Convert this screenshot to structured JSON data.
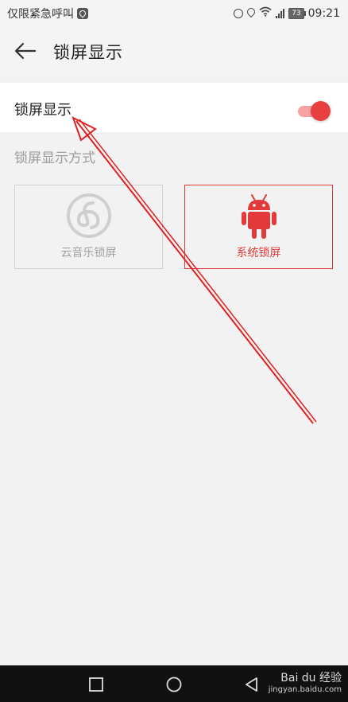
{
  "status_bar": {
    "carrier_text": "仅限紧急呼叫",
    "battery": "73",
    "time": "09:21"
  },
  "header": {
    "title": "锁屏显示",
    "back_icon": "arrow-left-icon"
  },
  "toggle_row": {
    "label": "锁屏显示",
    "enabled": true
  },
  "section": {
    "label": "锁屏显示方式"
  },
  "options": [
    {
      "label": "云音乐锁屏",
      "icon": "netease-music-icon",
      "selected": false
    },
    {
      "label": "系统锁屏",
      "icon": "android-icon",
      "selected": true
    }
  ],
  "colors": {
    "accent": "#e23a3a",
    "switch_track": "#f7a3a3",
    "background": "#f2f2f2"
  },
  "watermark": {
    "brand": "Bai du 经验",
    "url": "jingyan.baidu.com"
  }
}
